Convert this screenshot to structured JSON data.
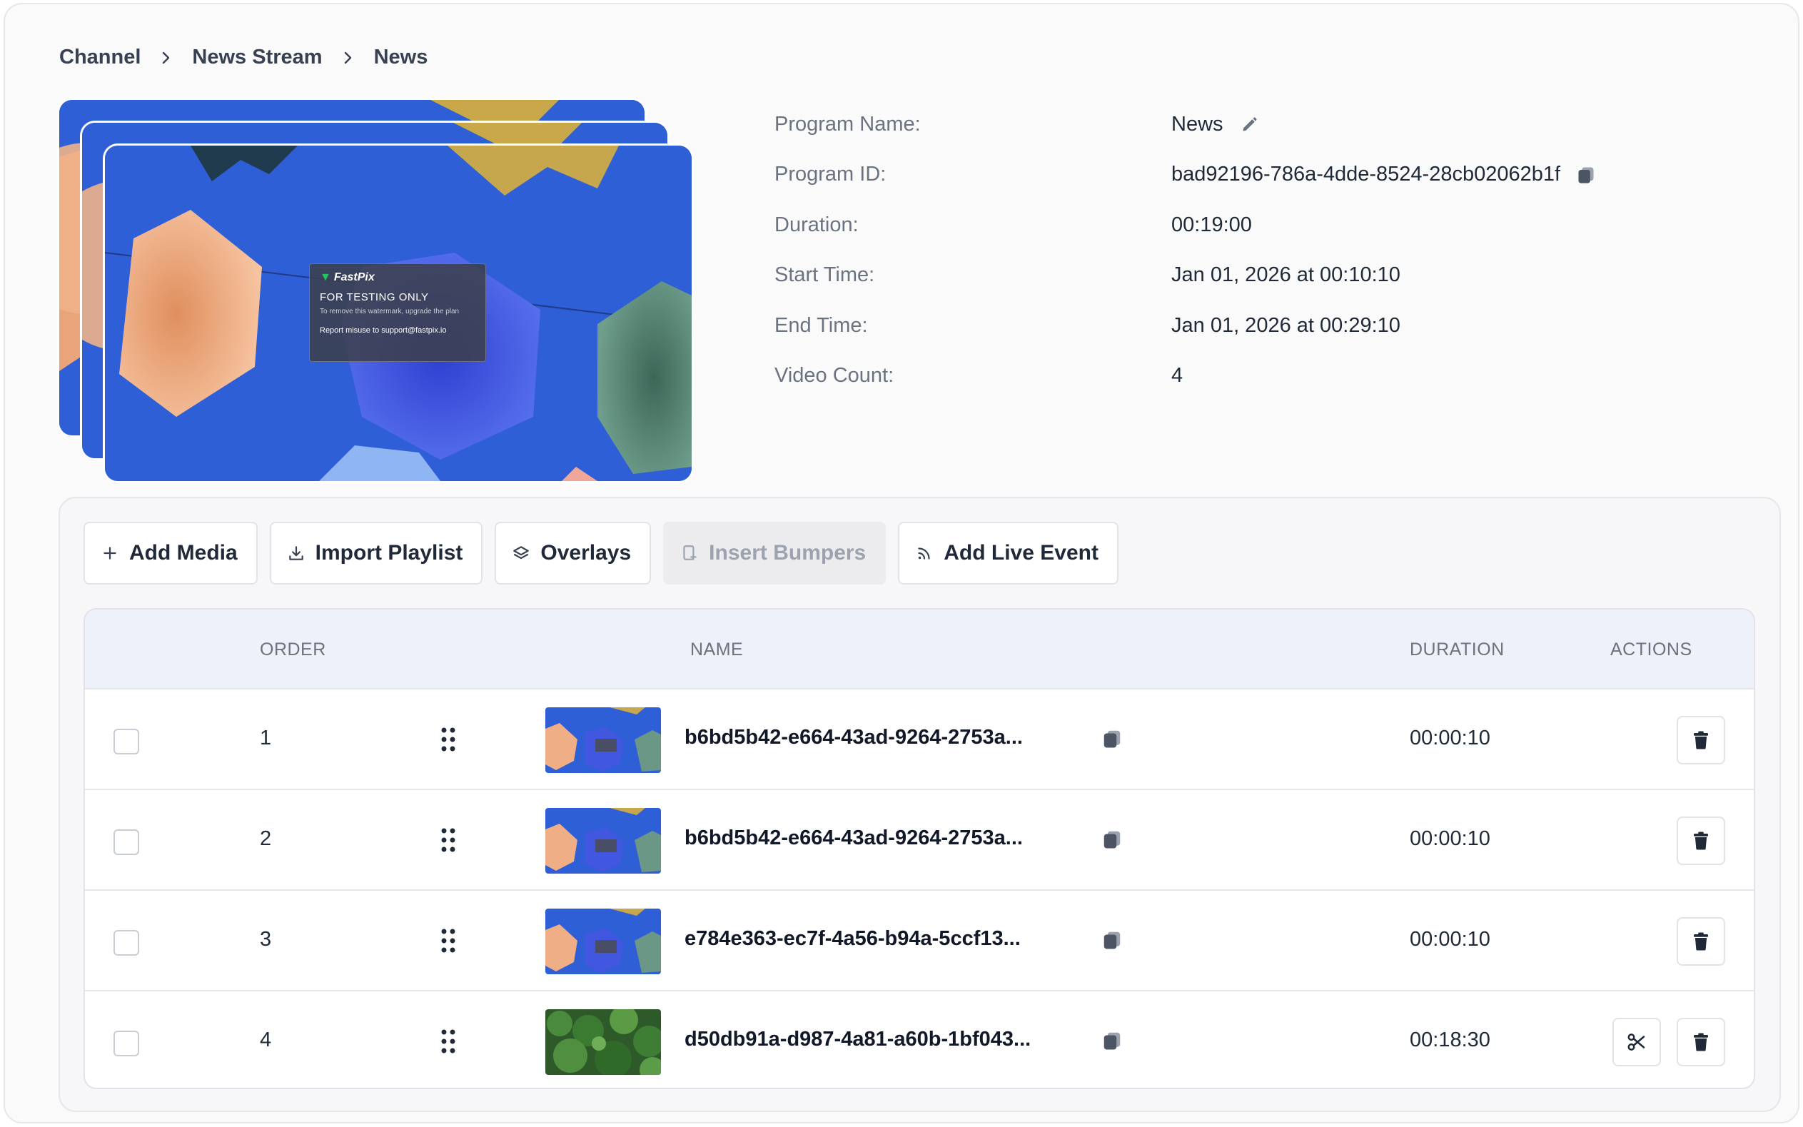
{
  "breadcrumb": [
    "Channel",
    "News Stream",
    "News"
  ],
  "preview": {
    "watermark": {
      "brand": "FastPix",
      "title": "FOR TESTING ONLY",
      "subtitle": "To remove this watermark, upgrade the plan",
      "footer": "Report misuse to support@fastpix.io"
    }
  },
  "program": {
    "name_label": "Program Name:",
    "name_value": "News",
    "id_label": "Program ID:",
    "id_value": "bad92196-786a-4dde-8524-28cb02062b1f",
    "duration_label": "Duration:",
    "duration_value": "00:19:00",
    "start_label": "Start Time:",
    "start_value": "Jan 01, 2026 at 00:10:10",
    "end_label": "End Time:",
    "end_value": "Jan 01, 2026 at 00:29:10",
    "count_label": "Video Count:",
    "count_value": "4"
  },
  "toolbar": {
    "add_media": "Add Media",
    "import_playlist": "Import Playlist",
    "overlays": "Overlays",
    "insert_bumpers": "Insert Bumpers",
    "add_live_event": "Add Live Event"
  },
  "table": {
    "headers": {
      "order": "ORDER",
      "name": "NAME",
      "duration": "DURATION",
      "actions": "ACTIONS"
    },
    "rows": [
      {
        "order": "1",
        "name": "b6bd5b42-e664-43ad-9264-2753a...",
        "duration": "00:00:10",
        "thumb": "umbrellas"
      },
      {
        "order": "2",
        "name": "b6bd5b42-e664-43ad-9264-2753a...",
        "duration": "00:00:10",
        "thumb": "umbrellas"
      },
      {
        "order": "3",
        "name": "e784e363-ec7f-4a56-b94a-5ccf13...",
        "duration": "00:00:10",
        "thumb": "umbrellas"
      },
      {
        "order": "4",
        "name": "d50db91a-d987-4a81-a60b-1bf043...",
        "duration": "00:18:30",
        "thumb": "foliage"
      }
    ]
  },
  "icons": {
    "breadcrumb_sep": "chevron-right-icon",
    "edit": "pencil-icon",
    "copy": "copy-icon",
    "drag": "drag-handle-icon",
    "delete": "trash-icon",
    "trim": "scissors-icon"
  },
  "colors": {
    "sky_blue": "#2f5fd6",
    "table_header": "#eef0fa"
  }
}
